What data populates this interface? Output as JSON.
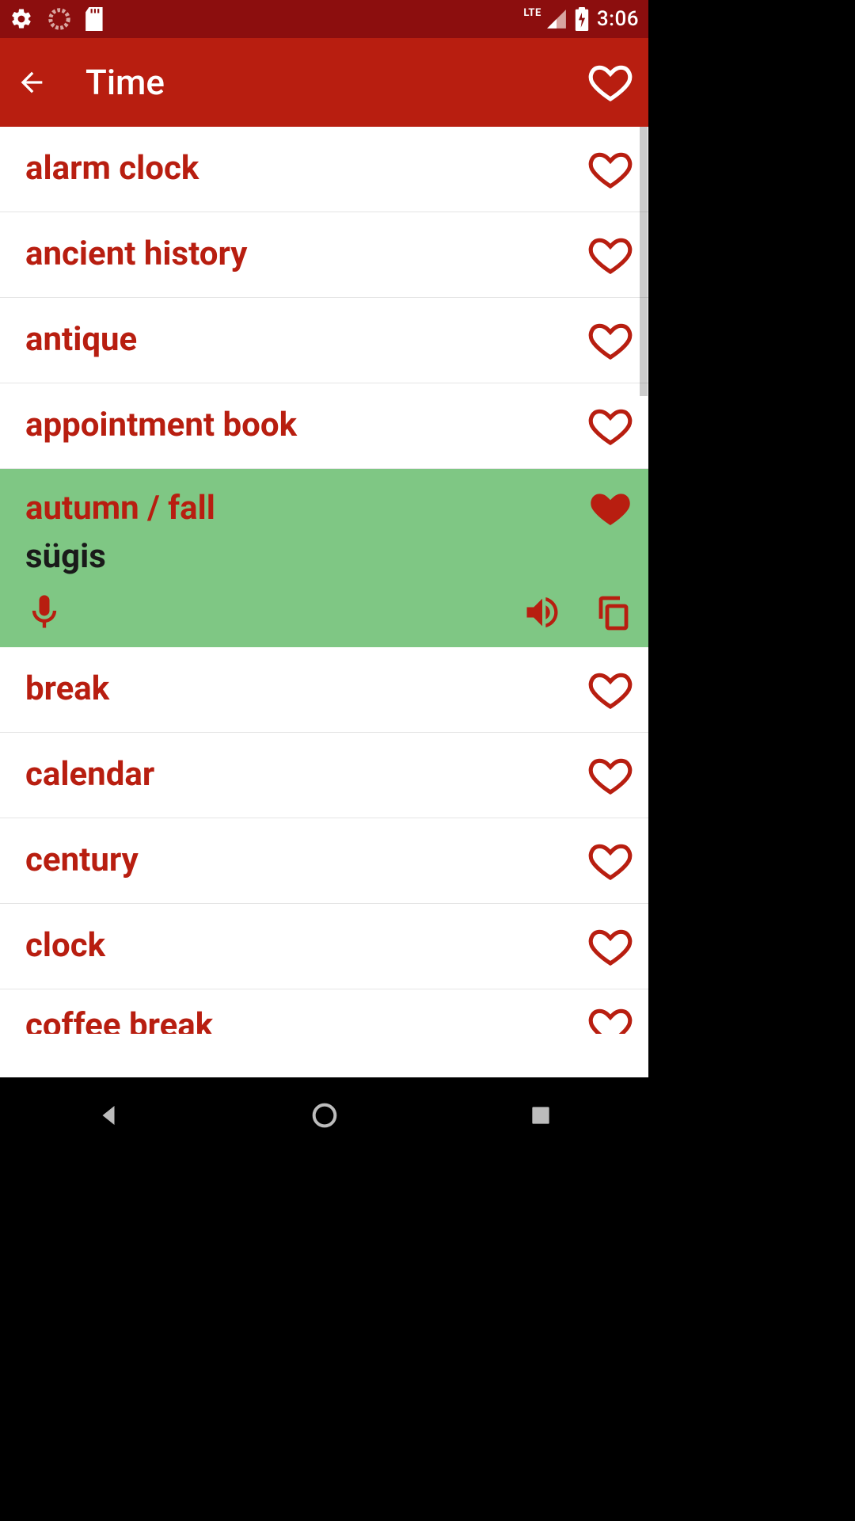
{
  "status": {
    "lte": "LTE",
    "time": "3:06"
  },
  "appbar": {
    "title": "Time"
  },
  "colors": {
    "primary": "#b81e10",
    "primaryDark": "#8c0e0e",
    "expandedBg": "#7fc784",
    "text": "#1a1a1a"
  },
  "icons": {
    "gear": "gear-icon",
    "loading": "loading-icon",
    "sd": "sd-card-icon",
    "signal": "signal-icon",
    "battery": "battery-charging-icon",
    "back": "back-arrow-icon",
    "heartOutline": "heart-outline-icon",
    "heartFilled": "heart-filled-icon",
    "mic": "microphone-icon",
    "speaker": "speaker-icon",
    "copy": "copy-icon",
    "navBack": "nav-back-icon",
    "navHome": "nav-home-icon",
    "navRecent": "nav-recent-icon"
  },
  "items": [
    {
      "label": "alarm clock",
      "favorited": false,
      "expanded": false
    },
    {
      "label": "ancient history",
      "favorited": false,
      "expanded": false
    },
    {
      "label": "antique",
      "favorited": false,
      "expanded": false
    },
    {
      "label": "appointment book",
      "favorited": false,
      "expanded": false
    },
    {
      "label": "autumn / fall",
      "favorited": true,
      "expanded": true,
      "translation": "sügis"
    },
    {
      "label": "break",
      "favorited": false,
      "expanded": false
    },
    {
      "label": "calendar",
      "favorited": false,
      "expanded": false
    },
    {
      "label": "century",
      "favorited": false,
      "expanded": false
    },
    {
      "label": "clock",
      "favorited": false,
      "expanded": false
    },
    {
      "label": "coffee break",
      "favorited": false,
      "expanded": false,
      "partial": true
    }
  ]
}
